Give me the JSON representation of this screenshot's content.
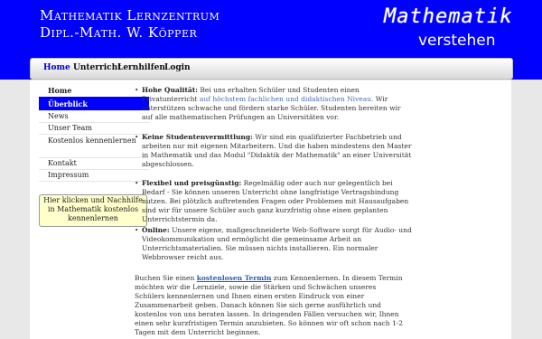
{
  "header": {
    "brand_line1": "Mathematik Lernzentrum",
    "brand_line2": "Dipl.-Math. W. Köpper",
    "logo_top": "Mathematik",
    "logo_bottom": "verstehen"
  },
  "nav": {
    "items": [
      "Home",
      "Unterricht",
      "Lernhilfen",
      "Login"
    ]
  },
  "sidebar": {
    "items": [
      "Home",
      "Überblick",
      "News",
      "Unser Team",
      "Kostenlos kennenlernen",
      "Kontakt",
      "Impressum"
    ],
    "cta": "Hier klicken und Nachhilfe in Mathematik kostenlos kennenlernen"
  },
  "main": {
    "b1_title": "Hohe Qualität:",
    "b1_text_a": " Bei uns erhalten Schüler und Studenten einen Privatunterricht ",
    "b1_link": "auf höchstem fachlichen und didaktischen Niveau.",
    "b1_text_b": " Wir unterstützen schwache und fördern starke Schüler. Studenten bereiten wir auf alle mathematischen Prüfungen an Universitäten vor.",
    "b2_title": "Keine Studentenvermittlung:",
    "b2_text": " Wir sind ein qualifizierter Fachbetrieb und arbeiten nur mit eigenen Mitarbeitern. Und die haben mindestens den Master in Mathematik und das Modul \"Didaktik der Mathematik\" an einer Universität abgeschlossen.",
    "b3_title": "Flexibel und preisgünstig:",
    "b3_text": " Regelmäßig oder auch nur gelegentlich bei Bedarf - Sie können unseren Unterricht ohne langfristige Vertragsbindung nutzen. Bei plötzlich auftretenden Fragen oder Problemen mit Hausaufgaben sind wir für unsere Schüler auch ganz kurzfristig ohne einen geplanten Unterrichtstermin da.",
    "b4_title": "Online:",
    "b4_text": " Unsere eigene, maßgeschneiderte Web-Software sorgt für Audio- und Videokommunikation und ermöglicht die gemeinsame Arbeit an Unterrichtsmaterialien. Sie müssen nichts installieren. Ein normaler Webbrowser reicht aus.",
    "p5_text_a": "Buchen Sie einen ",
    "p5_link": "kostenlosen Termin",
    "p5_text_b": " zum Kennenlernen. In diesem Termin möchten wir die Lernziele, sowie die Stärken und Schwächen unseres Schülers kennenlernen und Ihnen einen ersten Eindruck von einer Zusammenarbeit geben. Danach können Sie sich gerne ausführlich und kostenlos von uns beraten lassen. In dringenden Fällen versuchen wir, Ihnen einen sehr kurzfristigen Termin anzubieten. So können wir oft schon nach 1-2 Tagen mit dem Unterricht beginnen."
  },
  "colors": {
    "header_bg": "#0000ff",
    "selected_bg": "#0000ff",
    "cta_bg": "#ffffcc",
    "link": "#4a6fb0"
  }
}
